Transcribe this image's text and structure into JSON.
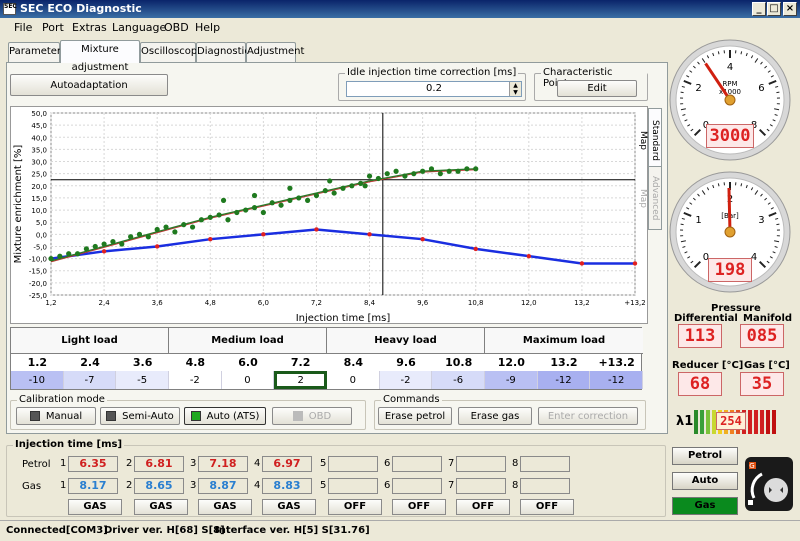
{
  "window": {
    "title": "SEC ECO Diagnostic",
    "icon_text": "SEC"
  },
  "menu": [
    "File",
    "Port",
    "Extras",
    "Language",
    "OBD",
    "Help"
  ],
  "tabs": [
    "Parameters",
    "Mixture adjustment",
    "Oscilloscopes",
    "Diagnostics",
    "Adjustment"
  ],
  "toolbar": {
    "autoadaptation_label": "Autoadaptation",
    "idle_label": "Idle injection time correction [ms]",
    "idle_value": "0.2",
    "char_points_label": "Characteristic Points",
    "edit_label": "Edit"
  },
  "side_tabs": {
    "standard": "Standard Map",
    "advanced": "Advanced Map"
  },
  "chart_data": {
    "type": "scatter",
    "xlabel": "Injection time [ms]",
    "ylabel": "Mixture enrichment [%]",
    "xlim": [
      1.2,
      14.4
    ],
    "ylim": [
      -25,
      50
    ],
    "x_ticks": [
      "1,2",
      "2,4",
      "3,6",
      "4,8",
      "6,0",
      "7,2",
      "8,4",
      "9,6",
      "10,8",
      "12,0",
      "13,2",
      "+13,2"
    ],
    "y_ticks": [
      "50,0",
      "45,0",
      "40,0",
      "35,0",
      "30,0",
      "25,0",
      "20,0",
      "15,0",
      "10,0",
      "5,0",
      "0,0",
      "-5,0",
      "-10,0",
      "-15,0",
      "-20,0",
      "-25,0"
    ],
    "cursor": {
      "x": 8.7,
      "y": 22.5
    },
    "series": [
      {
        "kind": "line",
        "color": "#1a2ee0",
        "x": [
          1.2,
          2.4,
          3.6,
          4.8,
          6.0,
          7.2,
          8.4,
          9.6,
          10.8,
          12.0,
          13.2,
          14.4
        ],
        "values": [
          -10,
          -7,
          -5,
          -2,
          0,
          2,
          0,
          -2,
          -6,
          -9,
          -12,
          -12
        ]
      },
      {
        "kind": "trend",
        "color": "#2a7a2a",
        "x": [
          1.2,
          2.4,
          3.6,
          4.8,
          6.0,
          7.2,
          8.4,
          9.6,
          10.8
        ],
        "values": [
          -11,
          -5,
          1,
          7,
          12,
          17,
          22,
          26,
          27
        ]
      },
      {
        "kind": "scatter",
        "color": "#1f7a1f",
        "x": [
          1.2,
          1.4,
          1.6,
          1.8,
          2.0,
          2.2,
          2.4,
          2.6,
          2.8,
          3.0,
          3.2,
          3.4,
          3.6,
          3.8,
          4.0,
          4.2,
          4.4,
          4.6,
          4.8,
          5.0,
          5.2,
          5.4,
          5.6,
          5.8,
          6.0,
          6.2,
          6.4,
          6.6,
          6.8,
          7.0,
          7.2,
          7.4,
          7.6,
          7.8,
          8.0,
          8.2,
          8.4,
          8.6,
          8.8,
          9.0,
          9.2,
          9.4,
          9.6,
          9.8,
          10.0,
          10.2,
          10.4,
          10.6,
          10.8,
          5.1,
          5.8,
          6.6,
          7.5,
          8.3
        ],
        "values": [
          -10,
          -9,
          -8,
          -8,
          -6,
          -5,
          -4,
          -3,
          -4,
          -1,
          0,
          -1,
          2,
          3,
          1,
          4,
          3,
          6,
          7,
          8,
          6,
          9,
          10,
          11,
          9,
          13,
          12,
          14,
          15,
          14,
          16,
          18,
          17,
          19,
          20,
          21,
          24,
          23,
          25,
          26,
          24,
          25,
          26,
          27,
          25,
          26,
          26,
          27,
          27,
          14,
          16,
          19,
          22,
          20
        ]
      }
    ]
  },
  "load_table": {
    "headers": [
      "Light load",
      "Medium load",
      "Heavy load",
      "Maximum load"
    ],
    "keys": [
      "1.2",
      "2.4",
      "3.6",
      "4.8",
      "6.0",
      "7.2",
      "8.4",
      "9.6",
      "10.8",
      "12.0",
      "13.2",
      "+13.2"
    ],
    "values": [
      "-10",
      "-7",
      "-5",
      "-2",
      "0",
      "2",
      "0",
      "-2",
      "-6",
      "-9",
      "-12",
      "-12"
    ]
  },
  "calibration": {
    "label": "Calibration mode",
    "modes": [
      "Manual",
      "Semi-Auto",
      "Auto (ATS)",
      "OBD"
    ],
    "active": "Auto (ATS)"
  },
  "commands": {
    "label": "Commands",
    "erase_petrol": "Erase petrol",
    "erase_gas": "Erase gas",
    "enter_correction": "Enter correction"
  },
  "injection": {
    "label": "Injection time [ms]",
    "row_petrol": "Petrol",
    "row_gas": "Gas",
    "indices": [
      "1",
      "2",
      "3",
      "4",
      "5",
      "6",
      "7",
      "8"
    ],
    "petrol": [
      "6.35",
      "6.81",
      "7.18",
      "6.97",
      "",
      "",
      "",
      ""
    ],
    "gas": [
      "8.17",
      "8.65",
      "8.87",
      "8.83",
      "",
      "",
      "",
      ""
    ],
    "fuel_buttons": [
      "GAS",
      "GAS",
      "GAS",
      "GAS",
      "OFF",
      "OFF",
      "OFF",
      "OFF"
    ],
    "petrol_color": "#d02020",
    "gas_color": "#2a7fd0"
  },
  "status": {
    "connected": "Connected[COM3]",
    "driver": "Driver ver. H[68] S[8]",
    "interface": "Interface ver. H[5] S[31.76]"
  },
  "rpm_gauge": {
    "unit": "RPM",
    "scale": "x1000",
    "ticks": [
      "0",
      "2",
      "4",
      "6",
      "8"
    ],
    "value": "3000",
    "value_num": 3.0
  },
  "pressure_gauge": {
    "unit": "[Bar]",
    "ticks": [
      "0",
      "1",
      "2",
      "3",
      "4"
    ],
    "value": "198",
    "value_num": 1.98
  },
  "pressure": {
    "title": "Pressure",
    "differential_label": "Differential",
    "differential": "113",
    "manifold_label": "Manifold",
    "manifold": "085",
    "reducer_label": "Reducer [°C]",
    "reducer": "68",
    "gas_label": "Gas [°C]",
    "gas": "35"
  },
  "lambda": {
    "label": "λ1",
    "value": "254"
  },
  "fuel_mode": {
    "petrol": "Petrol",
    "auto": "Auto",
    "gas": "Gas",
    "active": "Gas",
    "active_color": "#0a8a1e"
  }
}
